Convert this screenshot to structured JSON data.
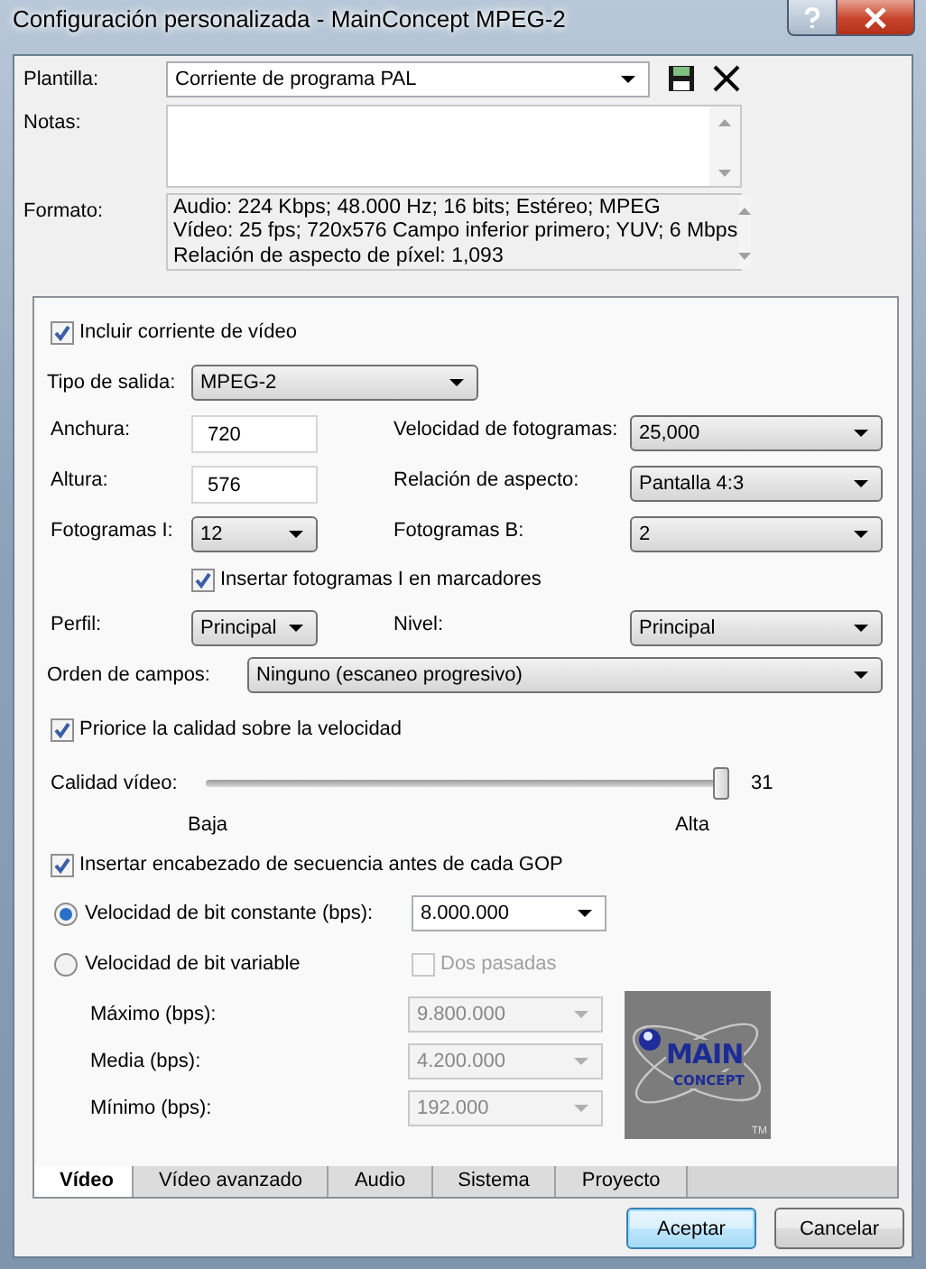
{
  "window": {
    "title": "Configuración personalizada - MainConcept MPEG-2"
  },
  "template": {
    "label": "Plantilla:",
    "value": "Corriente de programa PAL"
  },
  "notes": {
    "label": "Notas:"
  },
  "format": {
    "label": "Formato:",
    "lines": [
      "Audio: 224 Kbps; 48.000 Hz; 16 bits; Estéreo; MPEG",
      "Vídeo: 25 fps; 720x576 Campo inferior primero; YUV; 6 Mbps",
      "Relación de aspecto de píxel: 1,093"
    ]
  },
  "panel": {
    "include_video": {
      "label": "Incluir corriente de vídeo",
      "checked": true
    },
    "output_type": {
      "label": "Tipo de salida:",
      "value": "MPEG-2"
    },
    "width": {
      "label": "Anchura:",
      "value": "720"
    },
    "frame_rate": {
      "label": "Velocidad de fotogramas:",
      "value": "25,000"
    },
    "height": {
      "label": "Altura:",
      "value": "576"
    },
    "aspect": {
      "label": "Relación de aspecto:",
      "value": "Pantalla 4:3"
    },
    "i_frames": {
      "label": "Fotogramas I:",
      "value": "12"
    },
    "b_frames": {
      "label": "Fotogramas B:",
      "value": "2"
    },
    "insert_i_frames": {
      "label": "Insertar fotogramas I en marcadores",
      "checked": true
    },
    "profile": {
      "label": "Perfil:",
      "value": "Principal"
    },
    "level": {
      "label": "Nivel:",
      "value": "Principal"
    },
    "field_order": {
      "label": "Orden de campos:",
      "value": "Ninguno (escaneo progresivo)"
    },
    "prioritize": {
      "label": "Priorice la calidad sobre la velocidad",
      "checked": true
    },
    "quality": {
      "label": "Calidad vídeo:",
      "level": 1,
      "reading": "31",
      "min_label": "Baja",
      "max_label": "Alta"
    },
    "insert_header": {
      "label": "Insertar encabezado de secuencia antes de cada GOP",
      "checked": true
    },
    "constant_bitrate": {
      "label": "Velocidad de bit constante (bps):",
      "selected": true,
      "value": "8.000.000"
    },
    "variable_bitrate": {
      "label": "Velocidad de bit variable",
      "selected": false
    },
    "two_pass": {
      "label": "Dos pasadas",
      "checked": false,
      "disabled": true
    },
    "rates": [
      {
        "label": "Máximo (bps):",
        "value": "9.800.000",
        "disabled": true
      },
      {
        "label": "Media (bps):",
        "value": "4.200.000",
        "disabled": true
      },
      {
        "label": "Mínimo (bps):",
        "value": "192.000",
        "disabled": true
      }
    ],
    "logo": {
      "lines": [
        "MAIN",
        "CONCEPT"
      ],
      "mark": "TM"
    }
  },
  "tabs": [
    {
      "label": "Vídeo",
      "selected": true
    },
    {
      "label": "Vídeo avanzado",
      "selected": false
    },
    {
      "label": "Audio",
      "selected": false
    },
    {
      "label": "Sistema",
      "selected": false
    },
    {
      "label": "Proyecto",
      "selected": false
    }
  ],
  "buttons": [
    {
      "label": "Aceptar",
      "default": true
    },
    {
      "label": "Cancelar",
      "default": false
    }
  ]
}
